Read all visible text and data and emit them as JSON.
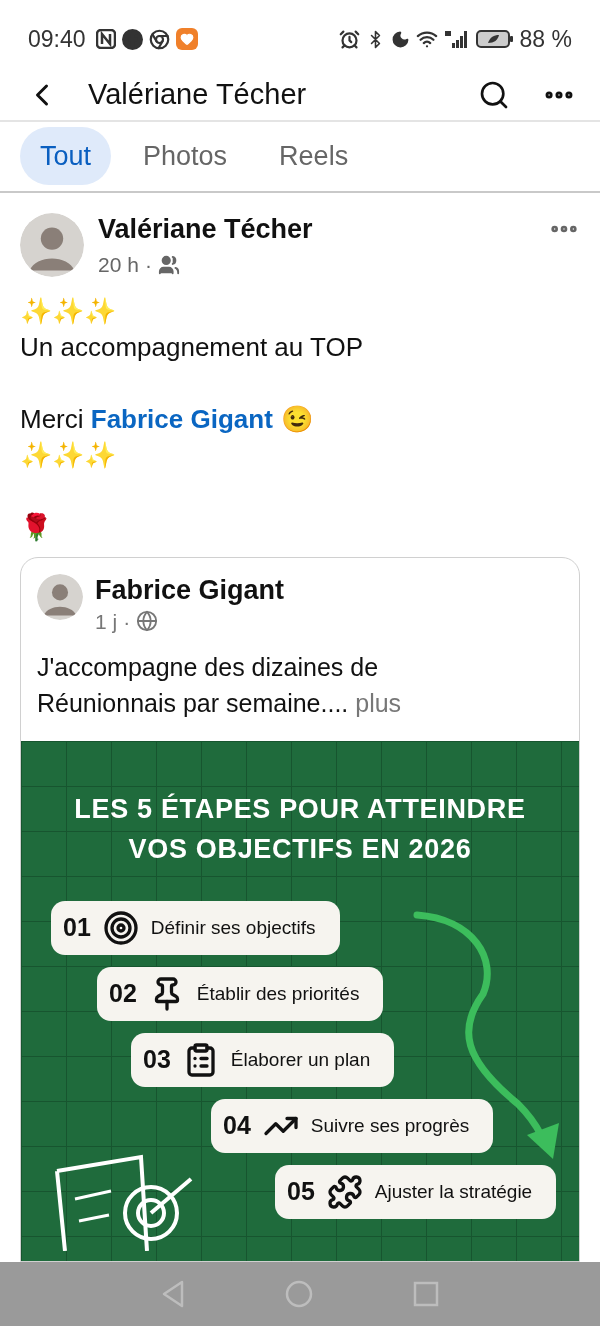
{
  "status_bar": {
    "time": "09:40",
    "battery": "88 %"
  },
  "header": {
    "title": "Valériane Técher"
  },
  "tabs": [
    {
      "label": "Tout",
      "selected": true
    },
    {
      "label": "Photos",
      "selected": false
    },
    {
      "label": "Reels",
      "selected": false
    }
  ],
  "post": {
    "author": "Valériane Técher",
    "time": "20 h",
    "separator": "·",
    "lines": [
      {
        "kind": "emoji",
        "text": "✨✨✨"
      },
      {
        "kind": "text",
        "text": "Un accompagnement au TOP"
      },
      {
        "kind": "blank"
      },
      {
        "kind": "mention",
        "before": "Merci ",
        "link": "Fabrice Gigant",
        "after": "😉"
      },
      {
        "kind": "emoji",
        "text": "✨✨✨"
      },
      {
        "kind": "blank"
      },
      {
        "kind": "emoji",
        "text": "🌹"
      }
    ],
    "shared": {
      "author": "Fabrice Gigant",
      "time": "1 j",
      "separator": "·",
      "text": "J'accompagne des dizaines de Réunionnais par semaine....",
      "more": "plus",
      "graphic": {
        "title_lines": [
          "LES 5 ÉTAPES POUR ATTEINDRE",
          "VOS OBJECTIFS EN 2026"
        ],
        "steps": [
          {
            "number": "01",
            "kind": "target",
            "label": "Définir ses objectifs"
          },
          {
            "number": "02",
            "kind": "pin",
            "label": "Établir des priorités"
          },
          {
            "number": "03",
            "kind": "clipboard",
            "label": "Élaborer un plan"
          },
          {
            "number": "04",
            "kind": "trend",
            "label": "Suivre ses progrès"
          },
          {
            "number": "05",
            "kind": "puzzle",
            "label": "Ajuster la stratégie"
          }
        ]
      }
    }
  }
}
